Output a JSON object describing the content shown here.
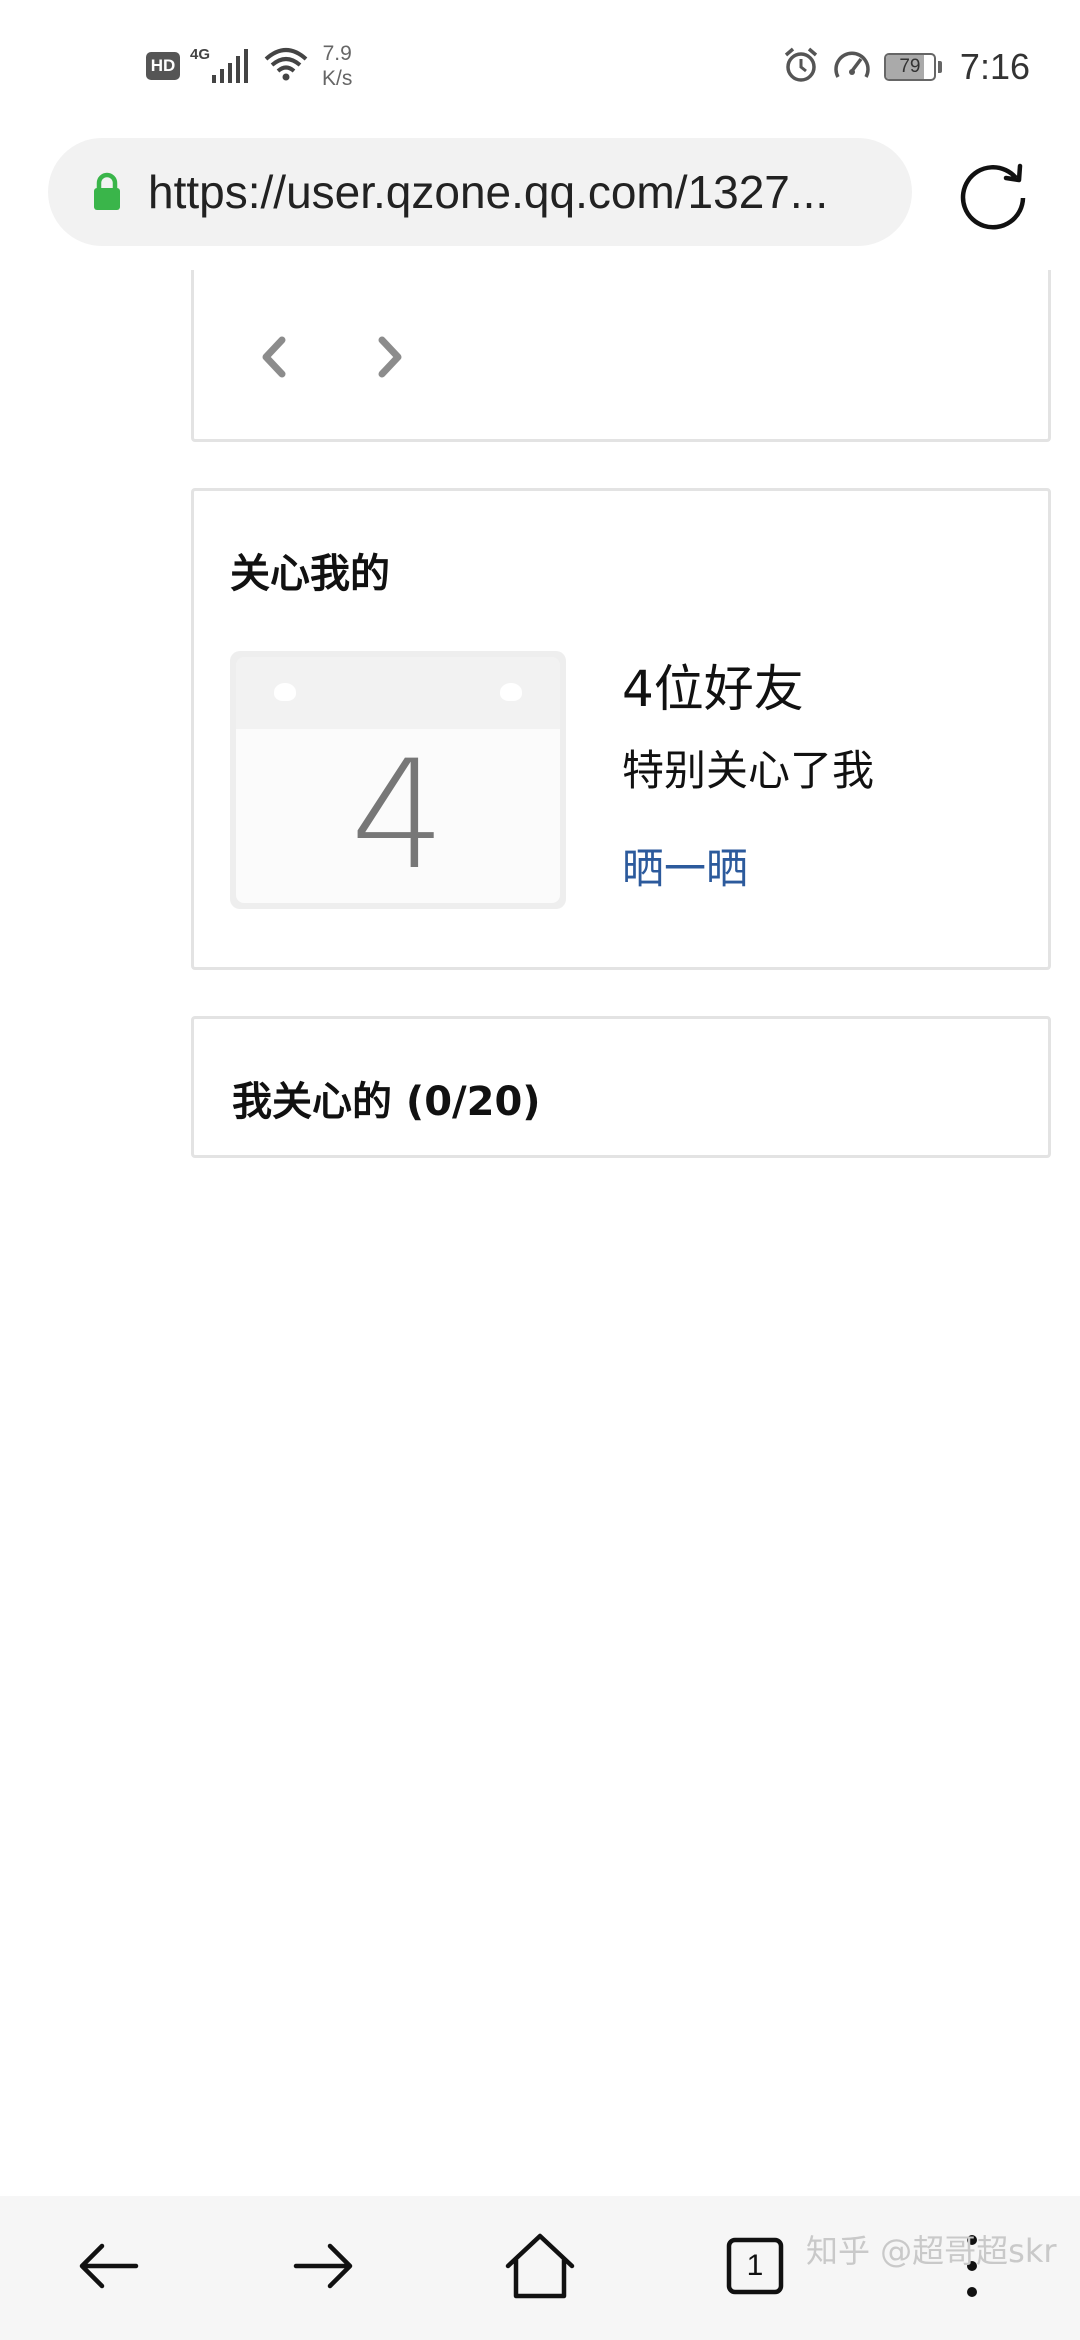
{
  "status_bar": {
    "hd": "HD",
    "network": "4G",
    "speed_value": "7.9",
    "speed_unit": "K/s",
    "battery": "79",
    "time": "7:16",
    "icons": [
      "signal-icon",
      "wifi-icon",
      "alarm-icon",
      "speed-icon",
      "battery-icon"
    ]
  },
  "browser": {
    "url": "https://user.qzone.qq.com/1327...",
    "lock_color": "#3ab54a",
    "icons": [
      "lock-icon",
      "reload-icon"
    ]
  },
  "pager": {
    "icons": [
      "chevron-left-icon",
      "chevron-right-icon"
    ]
  },
  "care_me": {
    "title": "关心我的",
    "calendar_number": "4",
    "friend_count": "4位好友",
    "description": "特别关心了我",
    "show_link": "晒一晒",
    "link_color": "#2c5a9c"
  },
  "my_care": {
    "title": "我关心的 (0/20)"
  },
  "bottom_nav": {
    "tab_count": "1",
    "icons": [
      "back-arrow-icon",
      "forward-arrow-icon",
      "home-icon",
      "tabs-icon",
      "more-icon"
    ]
  },
  "watermark": "知乎 @超哥超skr"
}
